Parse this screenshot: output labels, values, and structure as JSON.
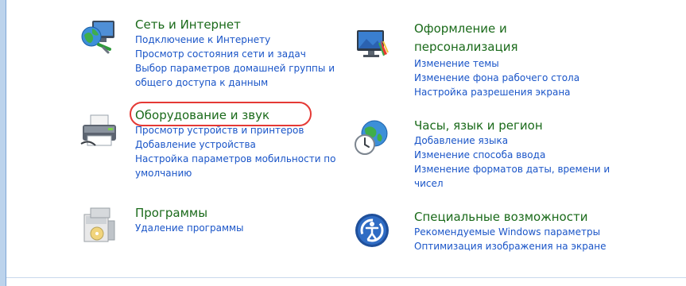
{
  "categories": {
    "network": {
      "title": "Сеть и Интернет",
      "links": [
        "Подключение к Интернету",
        "Просмотр состояния сети и задач",
        "Выбор параметров домашней группы и общего доступа к данным"
      ]
    },
    "hardware": {
      "title": "Оборудование и звук",
      "links": [
        "Просмотр устройств и принтеров",
        "Добавление устройства",
        "Настройка параметров мобильности по умолчанию"
      ]
    },
    "programs": {
      "title": "Программы",
      "links": [
        "Удаление программы"
      ]
    },
    "appearance": {
      "title": "Оформление и персонализация",
      "links": [
        "Изменение темы",
        "Изменение фона рабочего стола",
        "Настройка разрешения экрана"
      ]
    },
    "clock": {
      "title": "Часы, язык и регион",
      "links": [
        "Добавление языка",
        "Изменение способа ввода",
        "Изменение форматов даты, времени и чисел"
      ]
    },
    "access": {
      "title": "Специальные возможности",
      "links": [
        "Рекомендуемые Windows параметры",
        "Оптимизация изображения на экране"
      ]
    }
  },
  "colors": {
    "title_green": "#1a6a1a",
    "link_blue": "#1a55c8",
    "highlight_red": "#e53935"
  },
  "icons": [
    "network-globe-icon",
    "printer-icon",
    "programs-box-icon",
    "monitor-paint-icon",
    "clock-globe-icon",
    "accessibility-icon"
  ]
}
